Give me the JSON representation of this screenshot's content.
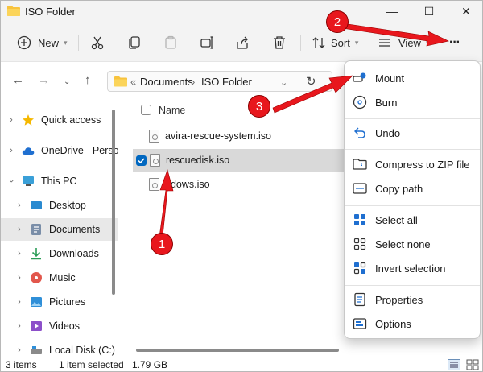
{
  "window": {
    "title": "ISO Folder"
  },
  "titlebar": {
    "minimize": "—",
    "maximize": "☐",
    "close": "✕"
  },
  "toolbar": {
    "new_label": "New",
    "sort_label": "Sort",
    "view_label": "View",
    "more_label": "···"
  },
  "navbar": {
    "overflow": "«",
    "crumbs": [
      "Documents",
      "ISO Folder"
    ],
    "separator": "›"
  },
  "sidebar": {
    "items": [
      {
        "label": "Quick access",
        "icon": "star-icon"
      },
      {
        "label": "OneDrive - Perso",
        "icon": "cloud-icon"
      },
      {
        "label": "This PC",
        "icon": "monitor-icon"
      },
      {
        "label": "Desktop",
        "icon": "desktop-icon"
      },
      {
        "label": "Documents",
        "icon": "documents-icon"
      },
      {
        "label": "Downloads",
        "icon": "download-icon"
      },
      {
        "label": "Music",
        "icon": "music-icon"
      },
      {
        "label": "Pictures",
        "icon": "pictures-icon"
      },
      {
        "label": "Videos",
        "icon": "videos-icon"
      },
      {
        "label": "Local Disk (C:)",
        "icon": "drive-icon"
      }
    ]
  },
  "files": {
    "column_name": "Name",
    "rows": [
      {
        "name": "avira-rescue-system.iso",
        "selected": false
      },
      {
        "name": "rescuedisk.iso",
        "selected": true
      },
      {
        "name": "ndows.iso",
        "selected": false
      }
    ]
  },
  "status": {
    "count": "3 items",
    "selection": "1 item selected",
    "size": "1.79 GB"
  },
  "menu": {
    "items": [
      {
        "label": "Mount",
        "icon": "mount-icon"
      },
      {
        "label": "Burn",
        "icon": "burn-icon"
      },
      {
        "label": "Undo",
        "icon": "undo-icon"
      },
      {
        "label": "Compress to ZIP file",
        "icon": "zip-icon"
      },
      {
        "label": "Copy path",
        "icon": "copy-path-icon"
      },
      {
        "label": "Select all",
        "icon": "select-all-icon"
      },
      {
        "label": "Select none",
        "icon": "select-none-icon"
      },
      {
        "label": "Invert selection",
        "icon": "invert-selection-icon"
      },
      {
        "label": "Properties",
        "icon": "properties-icon"
      },
      {
        "label": "Options",
        "icon": "options-icon"
      }
    ]
  },
  "callouts": [
    "1",
    "2",
    "3"
  ],
  "colors": {
    "accent": "#0067c0",
    "annotation": "#e8171d",
    "folder": "#f8c33d"
  }
}
